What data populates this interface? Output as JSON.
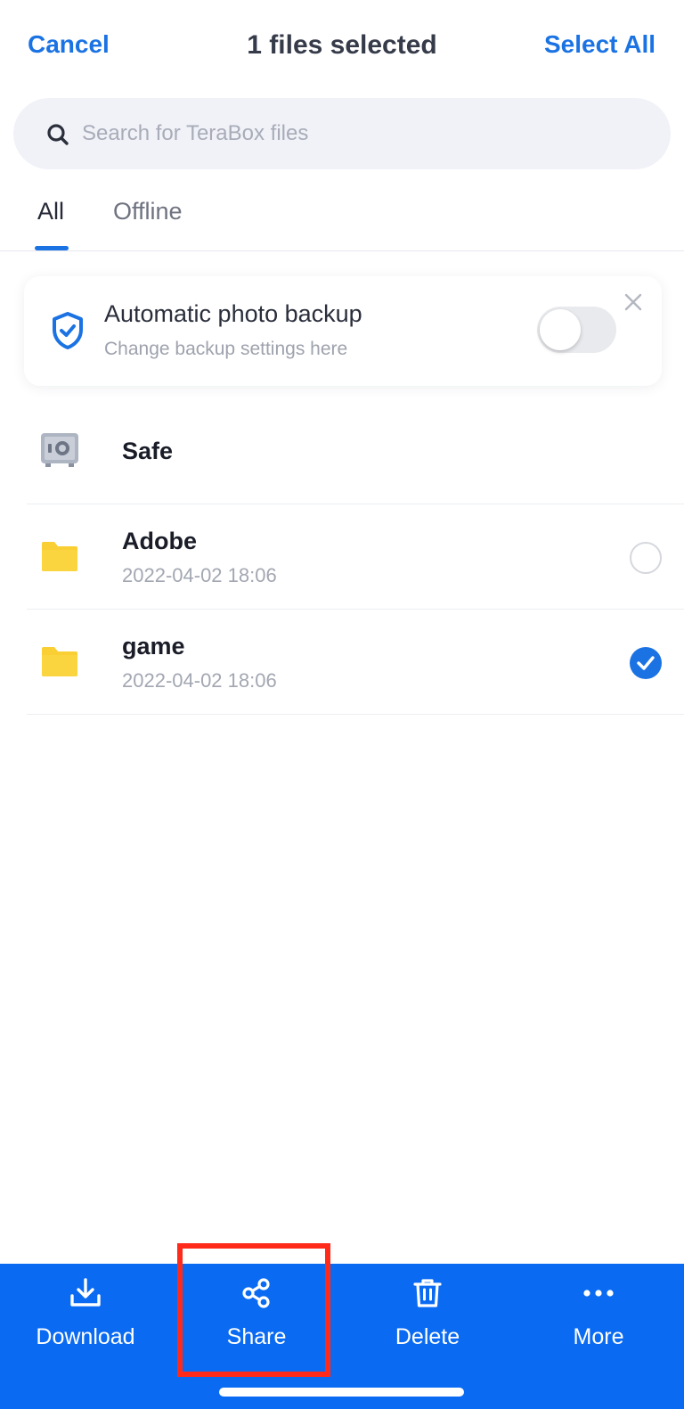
{
  "header": {
    "cancel_label": "Cancel",
    "title": "1 files selected",
    "select_all_label": "Select All"
  },
  "search": {
    "placeholder": "Search for TeraBox files",
    "icon": "search-icon"
  },
  "tabs": [
    {
      "label": "All",
      "active": true
    },
    {
      "label": "Offline",
      "active": false
    }
  ],
  "backup_card": {
    "title": "Automatic photo backup",
    "subtitle": "Change backup settings here",
    "toggle_on": false,
    "icon": "shield-check-icon"
  },
  "files": [
    {
      "name": "Safe",
      "date": "",
      "icon": "safe-icon",
      "selectable": false,
      "selected": false
    },
    {
      "name": "Adobe",
      "date": "2022-04-02 18:06",
      "icon": "folder-icon",
      "selectable": true,
      "selected": false
    },
    {
      "name": "game",
      "date": "2022-04-02 18:06",
      "icon": "folder-icon",
      "selectable": true,
      "selected": true
    }
  ],
  "toolbar": {
    "download_label": "Download",
    "share_label": "Share",
    "delete_label": "Delete",
    "more_label": "More"
  },
  "colors": {
    "accent": "#1b73e3",
    "toolbar_bg": "#0a6bf2",
    "folder": "#f9cf33",
    "highlight": "#ff2a1a"
  }
}
